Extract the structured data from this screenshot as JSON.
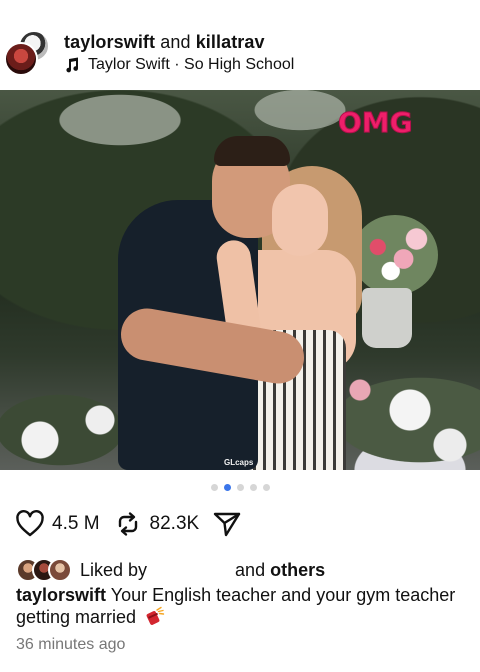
{
  "header": {
    "user_primary": "taylorswift",
    "connector": "and",
    "user_secondary": "killatrav",
    "music_icon": "music-note-icon",
    "music_text": "Taylor Swift · So High School"
  },
  "media": {
    "sticker_text": "OMG",
    "watermark_text": "GLcaps",
    "carousel_count": 5,
    "carousel_active_index": 1
  },
  "actions": {
    "like_icon": "heart-icon",
    "like_count": "4.5 M",
    "repost_icon": "repost-icon",
    "repost_count": "82.3K",
    "share_icon": "paper-plane-icon"
  },
  "likes": {
    "prefix": "Liked by",
    "suffix_and": "and",
    "suffix_others": "others"
  },
  "caption": {
    "username": "taylorswift",
    "text_line1": "Your English teacher and your gym teacher",
    "text_line2": "getting married",
    "emoji_icon": "firecracker-icon"
  },
  "timestamp": "36 minutes ago",
  "colors": {
    "accent_dot": "#3b76ea",
    "sticker": "#ee1f6a",
    "timestamp": "#777777"
  }
}
